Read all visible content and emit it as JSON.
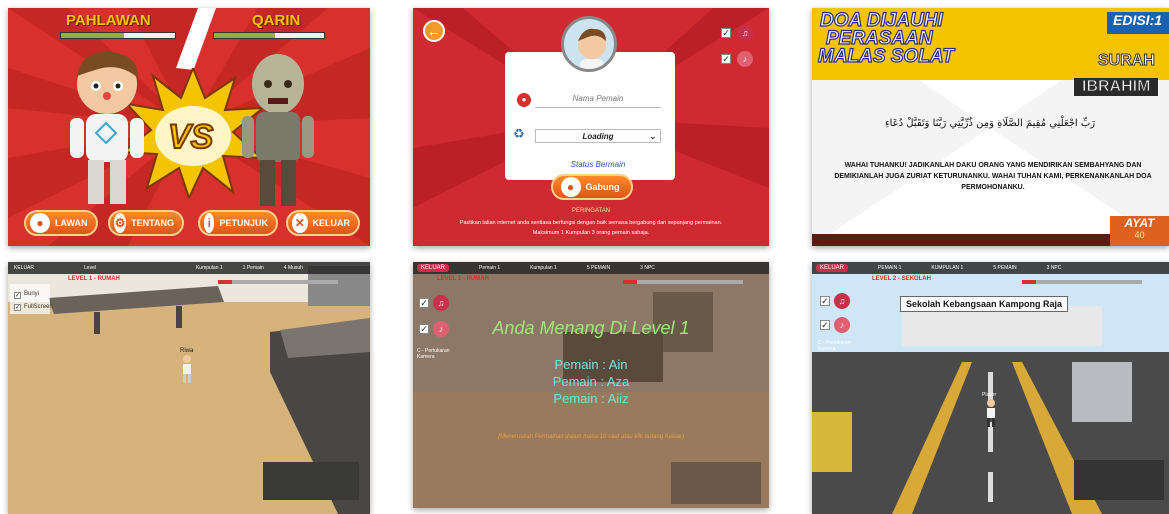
{
  "panel1": {
    "player_left": "PAHLAWAN",
    "player_right": "QARIN",
    "vs": "VS",
    "buttons": [
      "LAWAN",
      "TENTANG",
      "PETUNJUK",
      "KELUAR"
    ],
    "colors": {
      "bg": "#d8302c",
      "accent": "#f5c400"
    }
  },
  "panel2": {
    "name_placeholder": "Nama Pemain",
    "select_value": "Loading",
    "status": "Status Bermain",
    "join_button": "Gabung",
    "warning_title": "PERINGATAN",
    "warning_text_1": "Pastikan talian internet anda sentiasa berfungsi dengan baik semasa bergabung dan sepanjang permainan.",
    "warning_text_2": "Maksimum 1 Kumpulan 3 orang pemain sahaja."
  },
  "panel3": {
    "title_1": "DOA DIJAUHI",
    "title_2": "PERASAAN",
    "title_3": "MALAS SOLAT",
    "edition": "EDISI:1",
    "surah_1": "SURAH",
    "surah_2": "IBRAHIM",
    "arabic": "رَبِّ اجْعَلْنِي مُقِيمَ الصَّلَاةِ وَمِن ذُرِّيَّتِي رَبَّنَا وَتَقَبَّلْ دُعَاءِ",
    "translation": "Wahai Tuhanku! Jadikanlah daku orang yang mendirikan sembahyang dan demikianlah juga zuriat keturunanku. Wahai Tuhan kami, perkenankanlah doa permohonanku.",
    "ayat_label": "AYAT",
    "ayat_number": "40"
  },
  "panel4": {
    "hud": [
      "KELUAR",
      "Level",
      "Kumpulan 1",
      "1 Pemain",
      "4 Musuh"
    ],
    "level": "LEVEL 1 - RUMAH",
    "options": [
      "Bunyi",
      "FullScreen"
    ],
    "player_name": "Riwa"
  },
  "panel5": {
    "keluar": "KELUAR",
    "hud": [
      "Pemain 1",
      "Kumpulan 1",
      "5 PEMAIN",
      "3 NPC"
    ],
    "level": "LEVEL 1 - RUMAH",
    "camera_label": "C - Pertukaran Kamera",
    "win_title": "Anda Menang Di Level 1",
    "players": [
      "Pemain : Ain",
      "Pemain : Aza",
      "Pemain : Aiiz"
    ],
    "note": "(Meneruskan Permainan dalam masa 10 saat atau klik butang Keluar)"
  },
  "panel6": {
    "keluar": "KELUAR",
    "hud": [
      "PEMAIN 1",
      "KUMPULAN 1",
      "5 PEMAIN",
      "3 NPC"
    ],
    "level": "LEVEL 2 - SEKOLAH",
    "camera_label": "C - Pertukaran Kamera",
    "school_sign": "Sekolah Kebangsaan Kampong Raja",
    "player_label": "Player"
  }
}
